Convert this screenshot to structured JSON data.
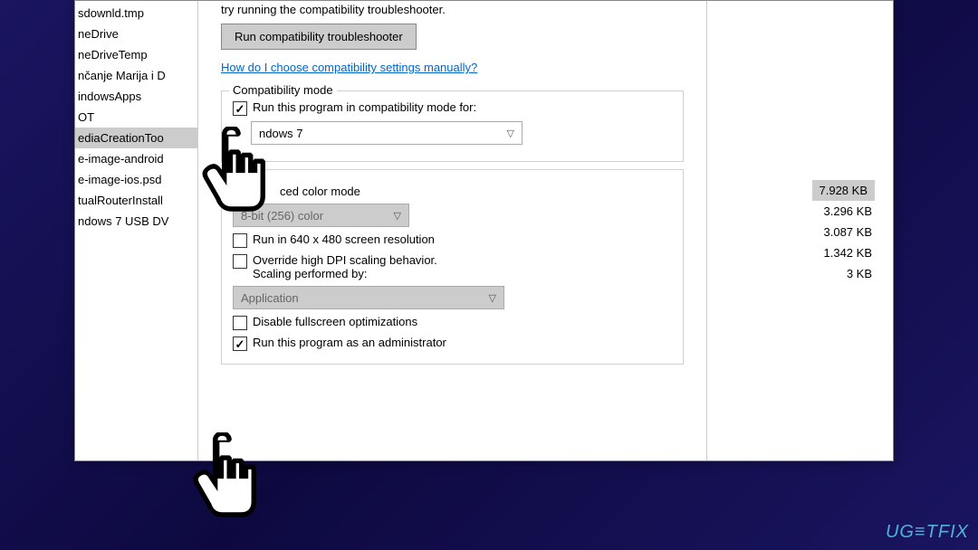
{
  "files": {
    "items": [
      "sdownld.tmp",
      "neDrive",
      "neDriveTemp",
      "nčanje Marija i D",
      "indowsApps",
      "OT",
      "ediaCreationToo",
      "e-image-android",
      "e-image-ios.psd",
      "tualRouterInstall",
      "ndows 7 USB DV"
    ],
    "sizes": [
      "7.928 KB",
      "3.296 KB",
      "3.087 KB",
      "1.342 KB",
      "3 KB"
    ]
  },
  "dialog": {
    "intro": "try running the compatibility troubleshooter.",
    "troubleshooter_btn": "Run compatibility troubleshooter",
    "help_link": "How do I choose compatibility settings manually?",
    "compat_mode": {
      "legend": "Compatibility mode",
      "check_label": "Run this program in compatibility mode for:",
      "os_value": "ndows 7"
    },
    "settings": {
      "reduced_color": "ced color mode",
      "color_value": "8-bit (256) color",
      "resolution": "Run in 640 x 480 screen resolution",
      "dpi_override": "Override high DPI scaling behavior.\nScaling performed by:",
      "dpi_line1": "Override high DPI scaling behavior.",
      "dpi_line2": "Scaling performed by:",
      "scaling_value": "Application",
      "disable_fullscreen": "Disable fullscreen optimizations",
      "run_admin": "Run this program as an administrator"
    }
  },
  "watermark": "UG≡TFIX"
}
